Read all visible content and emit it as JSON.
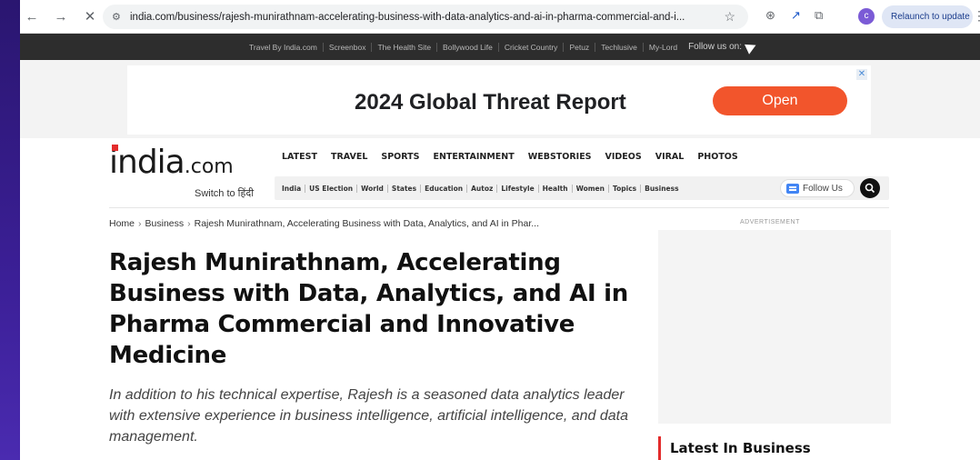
{
  "browser": {
    "url": "india.com/business/rajesh-munirathnam-accelerating-business-with-data-analytics-and-ai-in-pharma-commercial-and-i...",
    "relaunch_label": "Relaunch to update",
    "avatar_letter": "c"
  },
  "topstrip": {
    "links": [
      "Travel By India.com",
      "Screenbox",
      "The Health Site",
      "Bollywood Life",
      "Cricket Country",
      "Petuz",
      "Techlusive",
      "My-Lord"
    ],
    "follow_label": "Follow us on:"
  },
  "ad": {
    "title": "2024 Global Threat Report",
    "cta": "Open",
    "close": "✕",
    "cta_color": "#f2552c"
  },
  "header": {
    "logo_main": "india",
    "logo_suffix": ".com",
    "switch_label": "Switch to हिंदी",
    "main_nav": [
      "LATEST",
      "TRAVEL",
      "SPORTS",
      "ENTERTAINMENT",
      "WEBSTORIES",
      "VIDEOS",
      "VIRAL",
      "PHOTOS"
    ],
    "sub_nav": [
      "India",
      "US Election",
      "World",
      "States",
      "Education",
      "Autoz",
      "Lifestyle",
      "Health",
      "Women",
      "Topics",
      "Business"
    ],
    "follow_us": "Follow Us"
  },
  "breadcrumb": {
    "home": "Home",
    "section": "Business",
    "current": "Rajesh Munirathnam, Accelerating Business with Data, Analytics, and AI in Phar..."
  },
  "article": {
    "title": "Rajesh Munirathnam, Accelerating Business with Data, Analytics, and AI in Pharma Commercial and Innovative Medicine",
    "summary": "In addition to his technical expertise, Rajesh is a seasoned data analytics leader with extensive experience in business intelligence, artificial intelligence, and data management."
  },
  "sidebar": {
    "advertisement_label": "ADVERTISEMENT",
    "latest_heading": "Latest In Business"
  }
}
